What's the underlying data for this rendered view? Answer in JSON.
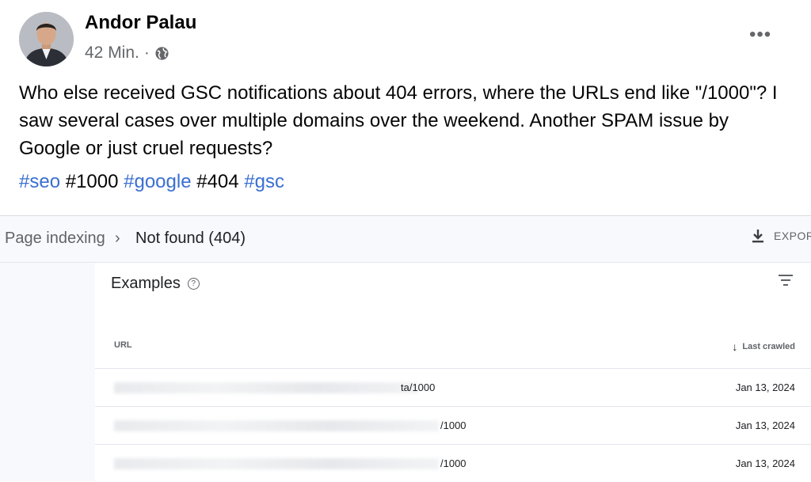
{
  "post": {
    "author": "Andor Palau",
    "time": "42 Min.",
    "separator": "·",
    "more_glyph": "•••",
    "text": "Who else received GSC notifications about 404 errors, where the URLs end like \"/1000\"? I saw several cases over multiple domains over the weekend. Another SPAM issue by Google or just cruel requests?",
    "hashtags": [
      {
        "text": "#seo",
        "link": true
      },
      {
        "text": "#1000",
        "link": false
      },
      {
        "text": "#google",
        "link": true
      },
      {
        "text": "#404",
        "link": false
      },
      {
        "text": "#gsc",
        "link": true
      }
    ]
  },
  "gsc": {
    "breadcrumb": {
      "parent": "Page indexing",
      "separator": "›",
      "current": "Not found (404)"
    },
    "export_label": "EXPOR",
    "examples_title": "Examples",
    "help_glyph": "?",
    "columns": {
      "url": "URL",
      "last_crawled": "Last crawled"
    },
    "rows": [
      {
        "url_suffix": "ta/1000",
        "date": "Jan 13, 2024"
      },
      {
        "url_suffix": "/1000",
        "date": "Jan 13, 2024"
      },
      {
        "url_suffix": "/1000",
        "date": "Jan 13, 2024"
      }
    ]
  },
  "colors": {
    "link": "#3a6fd1",
    "text": "#050505",
    "muted": "#65676b"
  }
}
